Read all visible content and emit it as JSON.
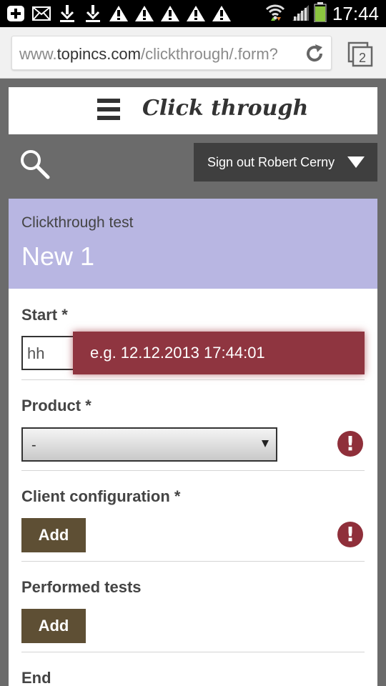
{
  "status_bar": {
    "time": "17:44",
    "notification_icons": [
      "add-box-icon",
      "mail-icon",
      "download-icon",
      "download-icon",
      "warning-icon",
      "warning-icon",
      "warning-icon",
      "warning-icon",
      "warning-icon"
    ]
  },
  "browser": {
    "url_prefix": "www.",
    "url_host": "topincs.com",
    "url_path": "/clickthrough/.form?",
    "tab_count": "2"
  },
  "app": {
    "title": "Click through",
    "sign_out_label": "Sign out Robert Cerny"
  },
  "form": {
    "kind": "Clickthrough test",
    "name": "New 1",
    "start_label": "Start *",
    "start_placeholder": "hh",
    "start_hint": "e.g. 12.12.2013 17:44:01",
    "product_label": "Product *",
    "product_value": "-",
    "client_config_label": "Client configuration *",
    "client_config_add": "Add",
    "performed_tests_label": "Performed tests",
    "performed_tests_add": "Add",
    "end_label": "End",
    "warning_glyph": "!"
  },
  "colors": {
    "header_bg": "#b8b6e2",
    "hint_bg": "#8f3540",
    "button_bg": "#5e4f34",
    "warning": "#8f2f3a"
  }
}
